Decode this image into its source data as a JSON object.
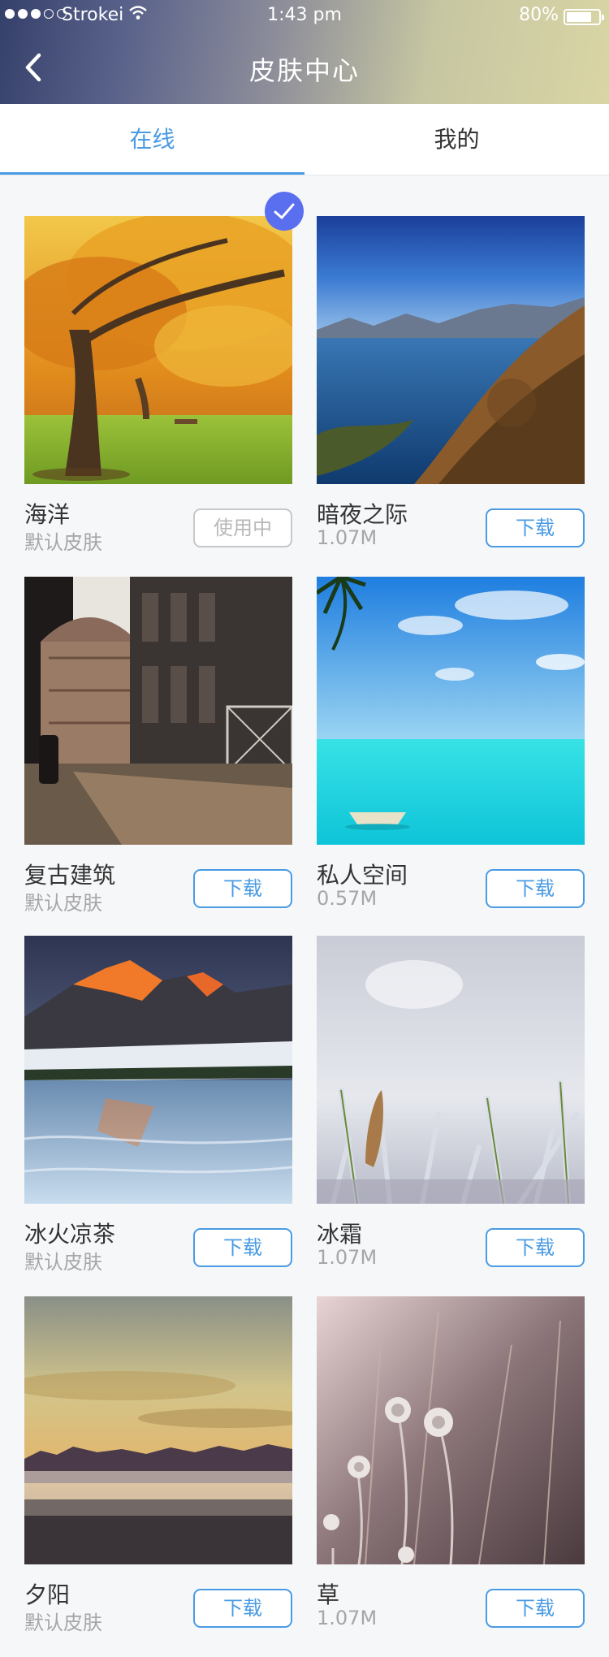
{
  "status_bar": {
    "carrier": "Strokei",
    "time": "1:43 pm",
    "battery": "80%",
    "battery_level": 0.8
  },
  "header": {
    "title": "皮肤中心",
    "back_icon": "chevron-left-icon"
  },
  "tabs": [
    {
      "label": "在线",
      "active": true
    },
    {
      "label": "我的",
      "active": false
    }
  ],
  "colors": {
    "accent": "#4a9be3",
    "check": "#5a6ef0"
  },
  "skins": [
    {
      "name": "海洋",
      "sub": "默认皮肤",
      "action": "使用中",
      "selected": true,
      "image": "autumn-tree"
    },
    {
      "name": "暗夜之际",
      "sub": "1.07M",
      "action": "下载",
      "image": "mountain-lake"
    },
    {
      "name": "复古建筑",
      "sub": "默认皮肤",
      "action": "下载",
      "image": "old-cathedral"
    },
    {
      "name": "私人空间",
      "sub": "0.57M",
      "action": "下载",
      "image": "tropical-sea-boat"
    },
    {
      "name": "冰火凉茶",
      "sub": "默认皮肤",
      "action": "下载",
      "image": "frozen-lake-mountains"
    },
    {
      "name": "冰霜",
      "sub": "1.07M",
      "action": "下载",
      "image": "frosted-grass"
    },
    {
      "name": "夕阳",
      "sub": "默认皮肤",
      "action": "下载",
      "image": "sunset-fog"
    },
    {
      "name": "草",
      "sub": "1.07M",
      "action": "下载",
      "image": "dry-flowers"
    }
  ]
}
